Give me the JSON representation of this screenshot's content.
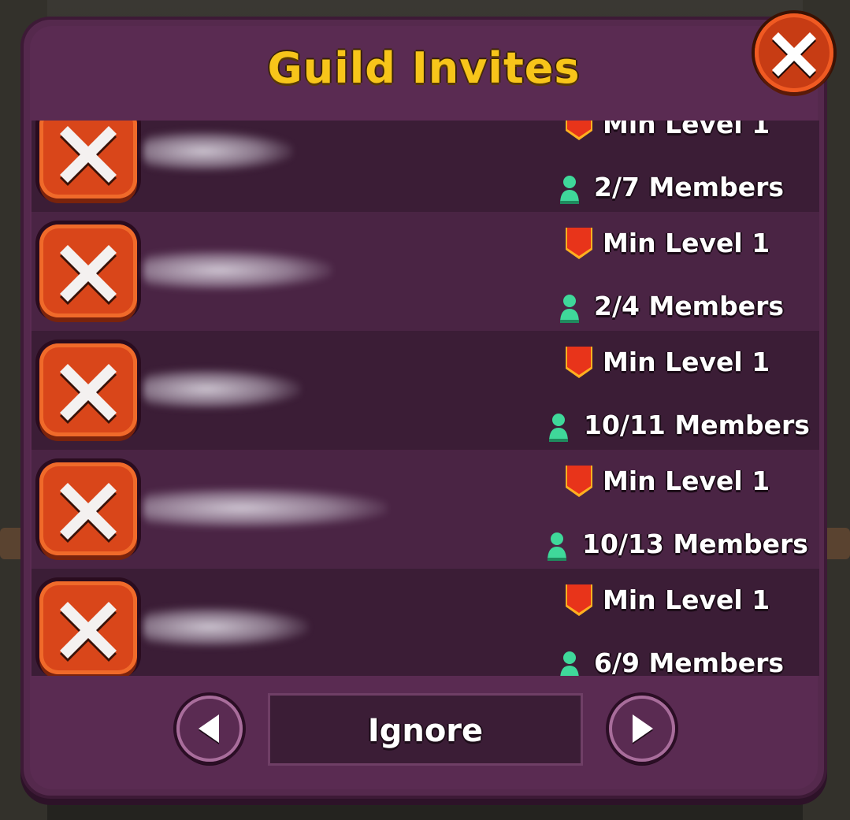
{
  "header": {
    "title": "Guild Invites"
  },
  "invites": [
    {
      "name": "",
      "min_level": "Min Level 1",
      "members": "2/7 Members"
    },
    {
      "name": "",
      "min_level": "Min Level 1",
      "members": "2/4 Members"
    },
    {
      "name": "",
      "min_level": "Min Level 1",
      "members": "10/11 Members"
    },
    {
      "name": "",
      "min_level": "Min Level 1",
      "members": "10/13 Members"
    },
    {
      "name": "",
      "min_level": "Min Level 1",
      "members": "6/9 Members"
    }
  ],
  "footer": {
    "ignore_label": "Ignore"
  },
  "icons": {
    "close": "close-icon",
    "decline": "decline-x-icon",
    "level": "shield-icon",
    "members": "person-icon",
    "prev": "arrow-left-icon",
    "next": "arrow-right-icon"
  },
  "colors": {
    "title": "#f7c51a",
    "panel": "#55294d",
    "decline_button": "#d9461a",
    "level_badge": "#e8341a",
    "member_icon": "#3fd89a"
  }
}
